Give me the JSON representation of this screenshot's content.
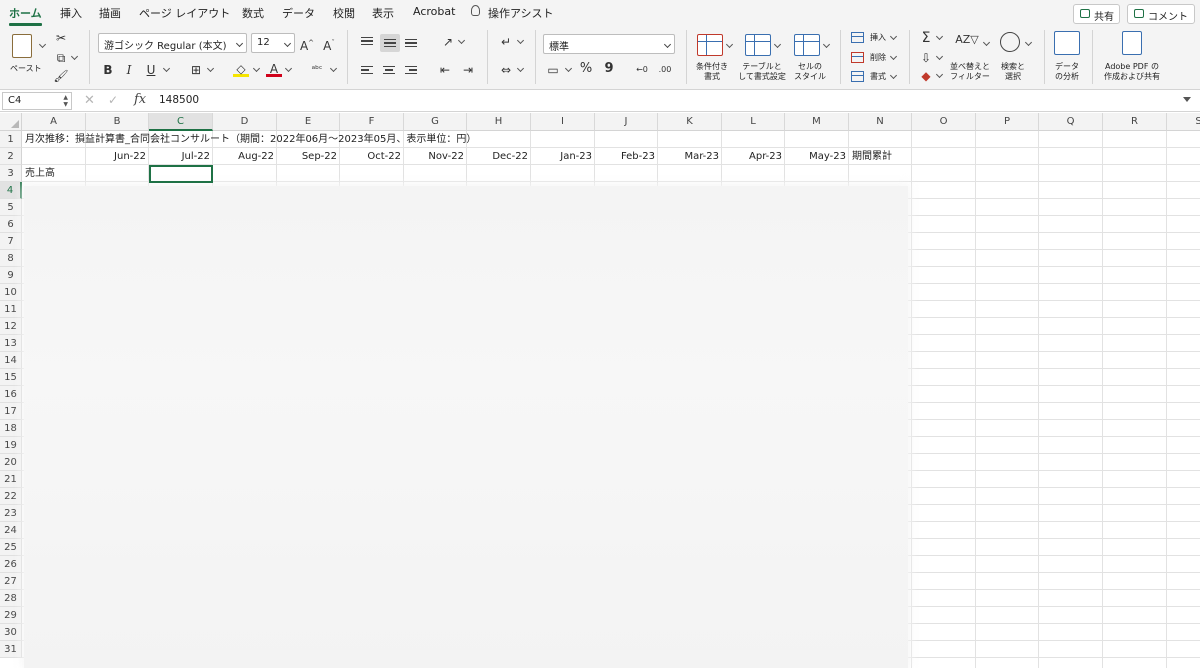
{
  "menu": {
    "tabs": [
      "ホーム",
      "挿入",
      "描画",
      "ページ レイアウト",
      "数式",
      "データ",
      "校閲",
      "表示",
      "Acrobat"
    ],
    "assist": "操作アシスト",
    "share": "共有",
    "comment": "コメント"
  },
  "ribbon": {
    "paste": "ペースト",
    "font_name": "游ゴシック Regular (本文)",
    "font_size": "12",
    "number_format": "標準",
    "cond_format": [
      "条件付き",
      "書式"
    ],
    "table_format": [
      "テーブルと",
      "して書式設定"
    ],
    "cell_style": [
      "セルの",
      "スタイル"
    ],
    "insert": "挿入",
    "delete": "削除",
    "format": "書式",
    "sort_filter": [
      "並べ替えと",
      "フィルター"
    ],
    "find_select": [
      "検索と",
      "選択"
    ],
    "analyze": [
      "データ",
      "の分析"
    ],
    "adobe": [
      "Adobe PDF の",
      "作成および共有"
    ],
    "bold": "B",
    "italic": "I",
    "underline": "U",
    "percent": "%",
    "comma": "9"
  },
  "formula_bar": {
    "name_box": "C4",
    "fx": "fx",
    "value": "148500"
  },
  "sheet": {
    "columns": [
      "A",
      "B",
      "C",
      "D",
      "E",
      "F",
      "G",
      "H",
      "I",
      "J",
      "K",
      "L",
      "M",
      "N",
      "O",
      "P",
      "Q",
      "R",
      "S"
    ],
    "rows": [
      "1",
      "2",
      "3",
      "4",
      "5",
      "6",
      "7",
      "8",
      "9",
      "10",
      "11",
      "12",
      "13",
      "14",
      "15",
      "16",
      "17",
      "18",
      "19",
      "20",
      "21",
      "22",
      "23",
      "24",
      "25",
      "26",
      "27",
      "28",
      "29",
      "30",
      "31"
    ],
    "title": "月次推移：損益計算書_合同会社コンサルート（期間：2022年06月〜2023年05月、表示単位：円）",
    "months": [
      "Jun-22",
      "Jul-22",
      "Aug-22",
      "Sep-22",
      "Oct-22",
      "Nov-22",
      "Dec-22",
      "Jan-23",
      "Feb-23",
      "Mar-23",
      "Apr-23",
      "May-23"
    ],
    "total_label": "期間累計",
    "a3": "売上高"
  }
}
